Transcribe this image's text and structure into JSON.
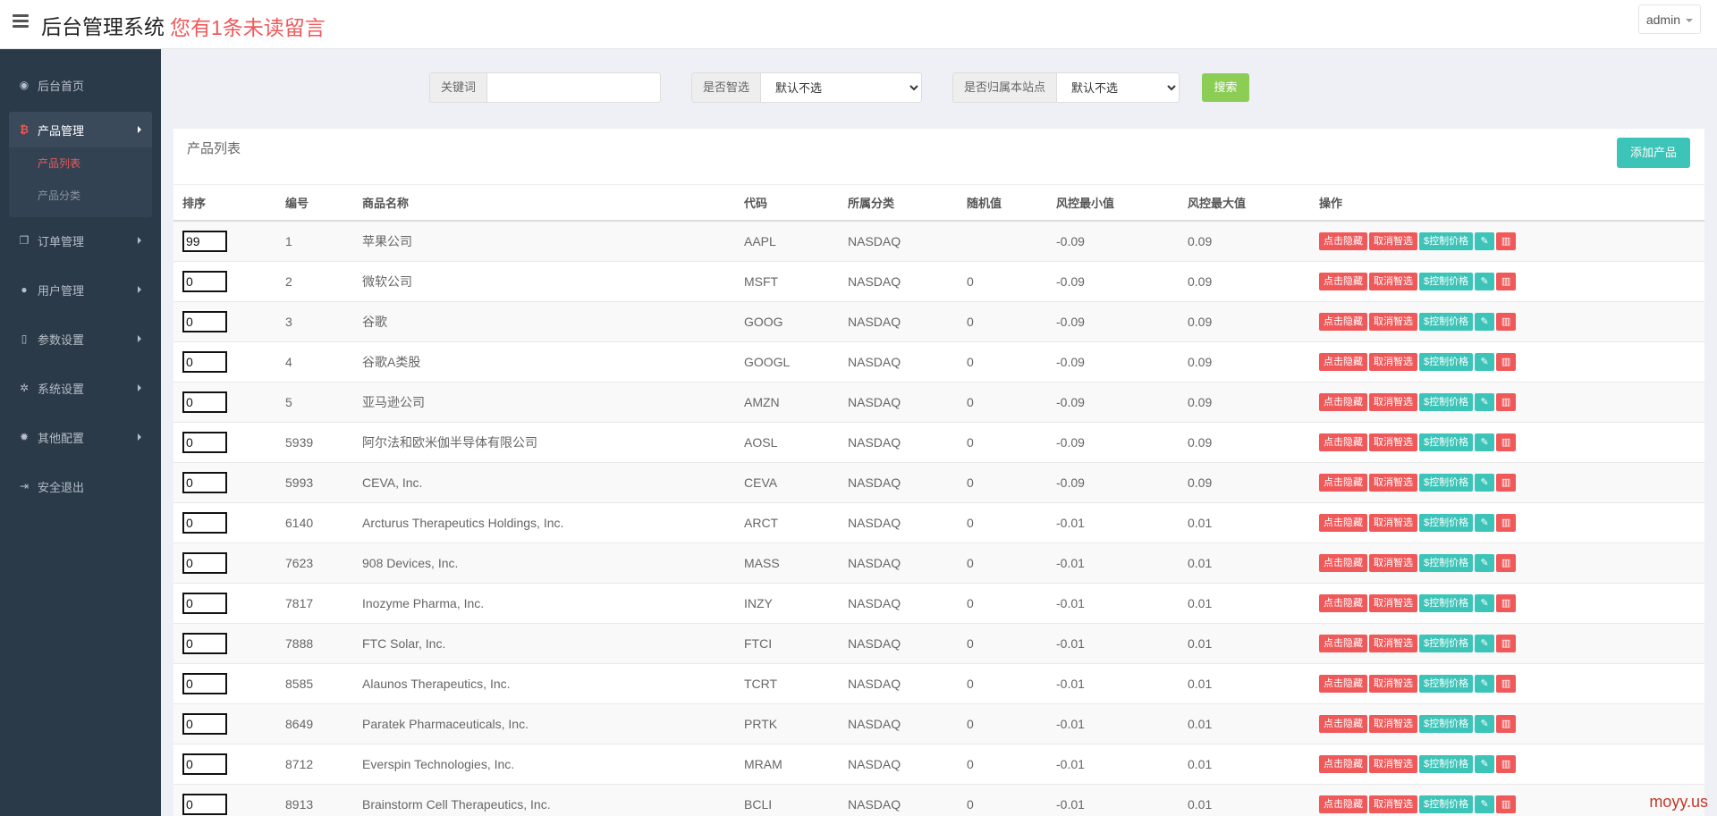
{
  "header": {
    "app_title": "后台管理系统",
    "unread_notice": "您有1条未读留言",
    "user": "admin"
  },
  "sidebar": {
    "items": [
      {
        "label": "后台首页",
        "icon": "dashboard-icon"
      },
      {
        "label": "产品管理",
        "icon": "bitcoin-icon"
      },
      {
        "label": "订单管理",
        "icon": "copy-icon"
      },
      {
        "label": "用户管理",
        "icon": "user-icon"
      },
      {
        "label": "参数设置",
        "icon": "file-icon"
      },
      {
        "label": "系统设置",
        "icon": "cogs-icon"
      },
      {
        "label": "其他配置",
        "icon": "gear-icon"
      },
      {
        "label": "安全退出",
        "icon": "sign-out-icon"
      }
    ],
    "sub_items": [
      "产品列表",
      "产品分类"
    ]
  },
  "filters": {
    "keyword_label": "关键词",
    "keyword_value": "",
    "smart_label": "是否智选",
    "smart_value": "默认不选",
    "site_label": "是否归属本站点",
    "site_value": "默认不选",
    "search_label": "搜索"
  },
  "panel": {
    "title": "产品列表",
    "add_label": "添加产品"
  },
  "table": {
    "columns": [
      "排序",
      "编号",
      "商品名称",
      "代码",
      "所属分类",
      "随机值",
      "风控最小值",
      "风控最大值",
      "操作"
    ],
    "actions": {
      "hide": "点击隐藏",
      "unsmart": "取消智选",
      "price": "$控制价格"
    },
    "rows": [
      {
        "sort": "99",
        "id": "1",
        "name": "苹果公司",
        "code": "AAPL",
        "category": "NASDAQ",
        "random": "",
        "min": "-0.09",
        "max": "0.09"
      },
      {
        "sort": "0",
        "id": "2",
        "name": "微软公司",
        "code": "MSFT",
        "category": "NASDAQ",
        "random": "0",
        "min": "-0.09",
        "max": "0.09"
      },
      {
        "sort": "0",
        "id": "3",
        "name": "谷歌",
        "code": "GOOG",
        "category": "NASDAQ",
        "random": "0",
        "min": "-0.09",
        "max": "0.09"
      },
      {
        "sort": "0",
        "id": "4",
        "name": "谷歌A类股",
        "code": "GOOGL",
        "category": "NASDAQ",
        "random": "0",
        "min": "-0.09",
        "max": "0.09"
      },
      {
        "sort": "0",
        "id": "5",
        "name": "亚马逊公司",
        "code": "AMZN",
        "category": "NASDAQ",
        "random": "0",
        "min": "-0.09",
        "max": "0.09"
      },
      {
        "sort": "0",
        "id": "5939",
        "name": "阿尔法和欧米伽半导体有限公司",
        "code": "AOSL",
        "category": "NASDAQ",
        "random": "0",
        "min": "-0.09",
        "max": "0.09"
      },
      {
        "sort": "0",
        "id": "5993",
        "name": "CEVA, Inc.",
        "code": "CEVA",
        "category": "NASDAQ",
        "random": "0",
        "min": "-0.09",
        "max": "0.09"
      },
      {
        "sort": "0",
        "id": "6140",
        "name": "Arcturus Therapeutics Holdings, Inc.",
        "code": "ARCT",
        "category": "NASDAQ",
        "random": "0",
        "min": "-0.01",
        "max": "0.01"
      },
      {
        "sort": "0",
        "id": "7623",
        "name": "908 Devices, Inc.",
        "code": "MASS",
        "category": "NASDAQ",
        "random": "0",
        "min": "-0.01",
        "max": "0.01"
      },
      {
        "sort": "0",
        "id": "7817",
        "name": "Inozyme Pharma, Inc.",
        "code": "INZY",
        "category": "NASDAQ",
        "random": "0",
        "min": "-0.01",
        "max": "0.01"
      },
      {
        "sort": "0",
        "id": "7888",
        "name": "FTC Solar, Inc.",
        "code": "FTCI",
        "category": "NASDAQ",
        "random": "0",
        "min": "-0.01",
        "max": "0.01"
      },
      {
        "sort": "0",
        "id": "8585",
        "name": "Alaunos Therapeutics, Inc.",
        "code": "TCRT",
        "category": "NASDAQ",
        "random": "0",
        "min": "-0.01",
        "max": "0.01"
      },
      {
        "sort": "0",
        "id": "8649",
        "name": "Paratek Pharmaceuticals, Inc.",
        "code": "PRTK",
        "category": "NASDAQ",
        "random": "0",
        "min": "-0.01",
        "max": "0.01"
      },
      {
        "sort": "0",
        "id": "8712",
        "name": "Everspin Technologies, Inc.",
        "code": "MRAM",
        "category": "NASDAQ",
        "random": "0",
        "min": "-0.01",
        "max": "0.01"
      },
      {
        "sort": "0",
        "id": "8913",
        "name": "Brainstorm Cell Therapeutics, Inc.",
        "code": "BCLI",
        "category": "NASDAQ",
        "random": "0",
        "min": "-0.01",
        "max": "0.01"
      }
    ]
  },
  "watermark": "moyy.us",
  "colors": {
    "sidebar": "#2b3a49",
    "accent_red": "#f0595a",
    "teal": "#3dc4b8",
    "green": "#8ccd55"
  }
}
